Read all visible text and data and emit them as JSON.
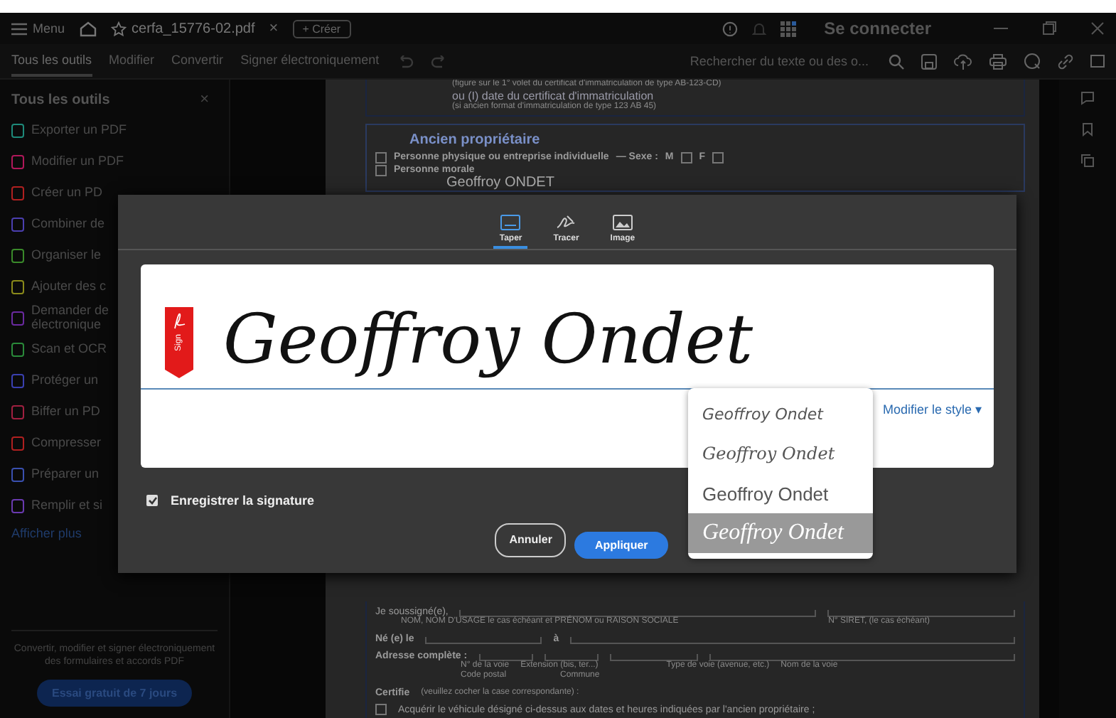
{
  "title_bar": {
    "menu_label": "Menu",
    "tab_title": "cerfa_15776-02.pdf",
    "tab_close": "×",
    "create_button": "+ Créer",
    "sign_in": "Se connecter"
  },
  "toolbar": {
    "tabs": [
      {
        "label": "Tous les outils",
        "selected": true
      },
      {
        "label": "Modifier",
        "selected": false
      },
      {
        "label": "Convertir",
        "selected": false
      },
      {
        "label": "Signer électroniquement",
        "selected": false
      }
    ],
    "search": {
      "placeholder": "Rechercher du texte ou des o..."
    }
  },
  "sidebar": {
    "title": "Tous les outils",
    "close": "×",
    "items": [
      {
        "label": "Exporter un PDF",
        "color": "#1e8a7a"
      },
      {
        "label": "Modifier un PDF",
        "color": "#b0185a"
      },
      {
        "label": "Créer un PD",
        "color": "#b02020"
      },
      {
        "label": "Combiner de",
        "color": "#4b3fb0"
      },
      {
        "label": "Organiser le",
        "color": "#3a8a2a"
      },
      {
        "label": "Ajouter des c",
        "color": "#8a8a1a"
      },
      {
        "label": "Demander de\nélectronique",
        "color": "#6a2aa0"
      },
      {
        "label": "Scan et OCR",
        "color": "#2a8a3a"
      },
      {
        "label": "Protéger un",
        "color": "#3a40b0"
      },
      {
        "label": "Biffer un PD",
        "color": "#a02040"
      },
      {
        "label": "Compresser",
        "color": "#b02020"
      },
      {
        "label": "Préparer un",
        "color": "#3a50b0"
      },
      {
        "label": "Remplir et si",
        "color": "#6a3ab0"
      }
    ],
    "more_link": "Afficher plus",
    "promo_text": "Convertir, modifier et signer électroniquement des formulaires et accords PDF",
    "trial_button": "Essai gratuit de 7 jours"
  },
  "document": {
    "top_lines": [
      "(figure sur le 1° volet du certificat d'immatriculation de type AB-123-CD)",
      "ou (I) date du certificat d'immatriculation",
      "(si ancien format d'immatriculation de type 123 AB 45)"
    ],
    "section_title": "Ancien propriétaire",
    "checkboxes": [
      {
        "label": "Personne physique ou entreprise individuelle",
        "checked": false
      },
      {
        "label": "Personne morale",
        "checked": false
      }
    ],
    "sex_label": "— Sexe :",
    "sex_options": [
      {
        "label": "M",
        "checked": false
      },
      {
        "label": "F",
        "checked": false
      }
    ],
    "name_value": "Geoffroy ONDET",
    "bottom": {
      "undersigned": "Je soussigné(e),",
      "name_hint": "NOM, NOM D'USAGE le cas échéant et PRÉNOM ou RAISON SOCIALE",
      "siret_hint": "N° SIRET, (le cas échéant)",
      "born": "Né (e) le",
      "at": "à",
      "address": "Adresse complète :",
      "address_hints": [
        "N° de la voie",
        "Extension (bis, ter...)",
        "Type de voie (avenue, etc.)",
        "Nom de la voie"
      ],
      "postal_hints": [
        "Code postal",
        "Commune"
      ],
      "certifies": "Certifie",
      "certifies_hint": "(veuillez cocher la case correspondante) :",
      "acquire": {
        "label": "Acquérir le véhicule désigné ci-dessus aux dates et heures indiquées par l'ancien propriétaire ;",
        "checked": false
      }
    }
  },
  "dialog": {
    "tabs": [
      {
        "label": "Taper",
        "kind": "type",
        "selected": true
      },
      {
        "label": "Tracer",
        "kind": "draw",
        "selected": false
      },
      {
        "label": "Image",
        "kind": "image",
        "selected": false
      }
    ],
    "sign_tag": "Sign",
    "signature": "Geoffroy Ondet",
    "style_link": "Modifier le style ▾",
    "style_options": [
      {
        "label": "Geoffroy Ondet",
        "selected": false
      },
      {
        "label": "Geoffroy Ondet",
        "selected": false
      },
      {
        "label": "Geoffroy Ondet",
        "selected": false
      },
      {
        "label": "Geoffroy Ondet",
        "selected": true
      }
    ],
    "save_signature": {
      "label": "Enregistrer la signature",
      "checked": true
    },
    "buttons": [
      {
        "label": "Annuler",
        "kind": "secondary"
      },
      {
        "label": "Appliquer",
        "kind": "primary"
      }
    ]
  }
}
